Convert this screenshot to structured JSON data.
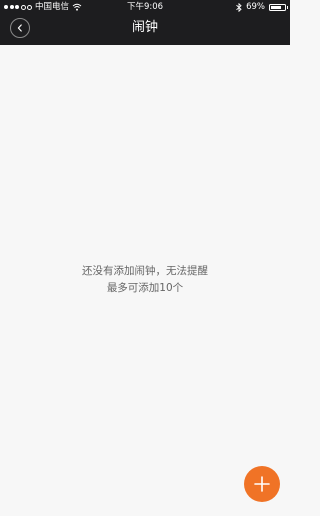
{
  "status_bar": {
    "carrier": "中国电信",
    "time": "下午9:06",
    "battery_percent": "69%",
    "battery_level": 0.69,
    "signal_bars": 3
  },
  "nav": {
    "title": "闹钟",
    "back_icon": "chevron-left-icon"
  },
  "empty_state": {
    "line1": "还没有添加闹钟，无法提醒",
    "line2": "最多可添加10个"
  },
  "fab": {
    "icon": "plus-icon",
    "color": "#f07326"
  },
  "colors": {
    "header_bg": "#1d1d1f",
    "page_bg": "#f7f7f7",
    "accent": "#f07326"
  }
}
